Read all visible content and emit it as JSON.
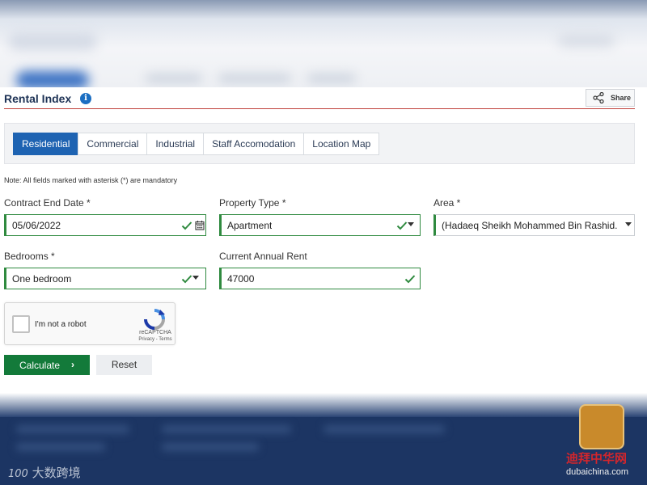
{
  "header": {
    "title": "Rental Index",
    "share_label": "Share"
  },
  "tabs": [
    {
      "label": "Residential",
      "active": true
    },
    {
      "label": "Commercial",
      "active": false
    },
    {
      "label": "Industrial",
      "active": false
    },
    {
      "label": "Staff Accomodation",
      "active": false
    },
    {
      "label": "Location Map",
      "active": false
    }
  ],
  "note": "Note: All fields marked with asterisk (*) are mandatory",
  "form": {
    "contract_end_date": {
      "label": "Contract End Date *",
      "value": "05/06/2022"
    },
    "property_type": {
      "label": "Property Type *",
      "value": "Apartment"
    },
    "area": {
      "label": "Area *",
      "value": "(Hadaeq Sheikh Mohammed Bin Rashid..."
    },
    "bedrooms": {
      "label": "Bedrooms *",
      "value": "One bedroom"
    },
    "annual_rent": {
      "label": "Current Annual Rent",
      "value": "47000"
    }
  },
  "recaptcha": {
    "label": "I'm not a robot",
    "brand": "reCAPTCHA",
    "terms": "Privacy - Terms"
  },
  "buttons": {
    "calculate": "Calculate",
    "reset": "Reset"
  },
  "watermarks": {
    "left_logo": "100",
    "left_text": "大数跨境",
    "right_text": "迪拜中华网",
    "right_url": "dubaichina.com"
  },
  "colors": {
    "accent": "#1e63b2",
    "valid": "#2f8a3f",
    "primary_button": "#137a3a",
    "title_rule": "#c0413b"
  },
  "icons": {
    "info": "info-icon",
    "share": "share-icon",
    "check": "check-icon",
    "calendar": "calendar-icon",
    "dropdown": "chevron-down-icon"
  }
}
